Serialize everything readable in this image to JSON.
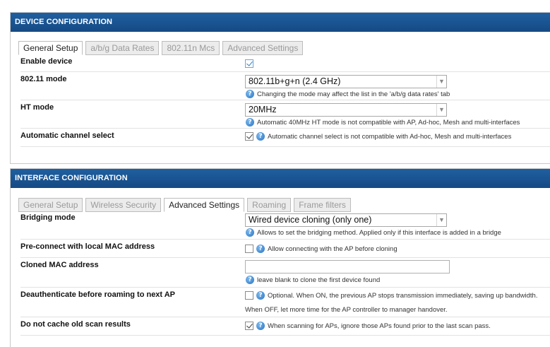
{
  "device": {
    "title": "DEVICE CONFIGURATION",
    "tabs": [
      "General Setup",
      "a/b/g Data Rates",
      "802.11n Mcs",
      "Advanced Settings"
    ],
    "enable_device": {
      "label": "Enable device",
      "checked": true
    },
    "mode": {
      "label": "802.11 mode",
      "value": "802.11b+g+n (2.4 GHz)",
      "hint": "Changing the mode may affect the list in the 'a/b/g data rates' tab"
    },
    "ht_mode": {
      "label": "HT mode",
      "value": "20MHz",
      "hint": "Automatic 40MHz HT mode is not compatible with AP, Ad-hoc, Mesh and multi-interfaces"
    },
    "auto_channel": {
      "label": "Automatic channel select",
      "checked": true,
      "hint": "Automatic channel select is not compatible with Ad-hoc, Mesh and multi-interfaces"
    }
  },
  "interface": {
    "title": "INTERFACE CONFIGURATION",
    "tabs": [
      "General Setup",
      "Wireless Security",
      "Advanced Settings",
      "Roaming",
      "Frame filters"
    ],
    "bridging": {
      "label": "Bridging mode",
      "value": "Wired device cloning (only one)",
      "hint": "Allows to set the bridging method. Applied only if this interface is added in a bridge"
    },
    "preconnect": {
      "label": "Pre-connect with local MAC address",
      "checked": false,
      "hint": "Allow connecting with the AP before cloning"
    },
    "cloned_mac": {
      "label": "Cloned MAC address",
      "value": "",
      "hint": "leave blank to clone the first device found"
    },
    "deauth": {
      "label": "Deauthenticate before roaming to next AP",
      "checked": false,
      "hint": "Optional. When ON, the previous AP stops transmission immediately, saving up bandwidth.",
      "hint2": "When OFF, let more time for the AP controller to manager handover."
    },
    "no_cache": {
      "label": "Do not cache old scan results",
      "checked": true,
      "hint": "When scanning for APs, ignore those APs found prior to the last scan pass."
    }
  },
  "icons": {
    "info": "info-icon",
    "dropdown": "chevron-down-icon"
  },
  "colors": {
    "header_bg": "#1a5694",
    "header_text": "#ffffff",
    "tab_inactive_text": "#9a9a9a"
  }
}
